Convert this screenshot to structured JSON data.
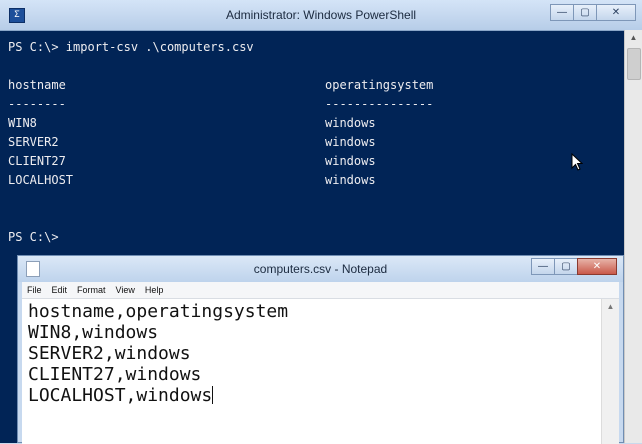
{
  "powershell": {
    "title": "Administrator: Windows PowerShell",
    "icon_glyph": "Σ",
    "window_buttons": {
      "minimize": "—",
      "maximize": "▢",
      "close": "✕"
    },
    "lines": {
      "prompt_command": "PS C:\\> import-csv .\\computers.csv",
      "header_hostname": "hostname",
      "header_os": "operatingsystem",
      "underline_hostname": "--------",
      "underline_os": "---------------",
      "final_prompt": "PS C:\\>"
    },
    "rows": [
      {
        "hostname": "WIN8",
        "os": "windows"
      },
      {
        "hostname": "SERVER2",
        "os": "windows"
      },
      {
        "hostname": "CLIENT27",
        "os": "windows"
      },
      {
        "hostname": "LOCALHOST",
        "os": "windows"
      }
    ],
    "colors": {
      "background": "#012456",
      "text": "#eeedf0"
    }
  },
  "notepad": {
    "title": "computers.csv - Notepad",
    "window_buttons": {
      "minimize": "—",
      "maximize": "▢",
      "close": "✕"
    },
    "menu": [
      "File",
      "Edit",
      "Format",
      "View",
      "Help"
    ],
    "content_lines": [
      "hostname,operatingsystem",
      "WIN8,windows",
      "SERVER2,windows",
      "CLIENT27,windows",
      "LOCALHOST,windows"
    ]
  },
  "icons": {
    "mouse": "mouse-pointer-icon",
    "scroll_up": "▲"
  }
}
